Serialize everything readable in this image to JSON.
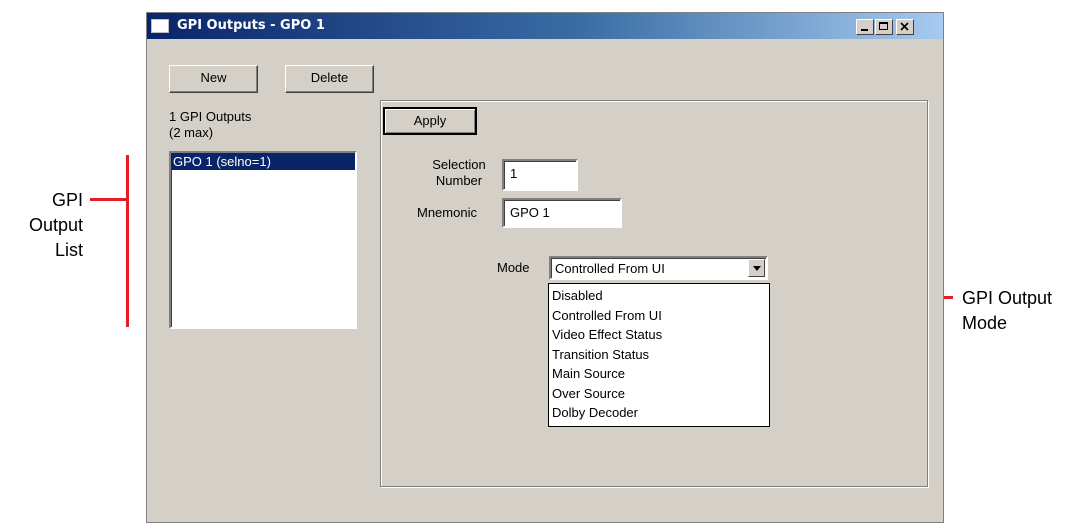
{
  "window": {
    "title": "GPI Outputs - GPO 1"
  },
  "toolbar": {
    "new_label": "New",
    "delete_label": "Delete"
  },
  "list": {
    "count_label": "1 GPI Outputs",
    "max_label": "(2 max)",
    "items": [
      {
        "label": "GPO 1 (selno=1)",
        "selected": true
      }
    ]
  },
  "details": {
    "apply_label": "Apply",
    "selection_number_label_line1": "Selection",
    "selection_number_label_line2": "Number",
    "selection_number_value": "1",
    "mnemonic_label": "Mnemonic",
    "mnemonic_value": "GPO 1",
    "mode_label": "Mode",
    "mode_value": "Controlled From UI",
    "mode_options": [
      "Disabled",
      "Controlled From UI",
      "Video Effect Status",
      "Transition Status",
      "Main Source",
      "Over Source",
      "Dolby Decoder"
    ]
  },
  "annotations": {
    "left_line1": "GPI",
    "left_line2": "Output",
    "left_line3": "List",
    "right_line1": "GPI Output",
    "right_line2": "Mode",
    "line_color": "#e41e26"
  },
  "colors": {
    "window_bg": "#d4d0c8",
    "selection_bg": "#0a246a",
    "titlebar_start": "#0a246a"
  }
}
